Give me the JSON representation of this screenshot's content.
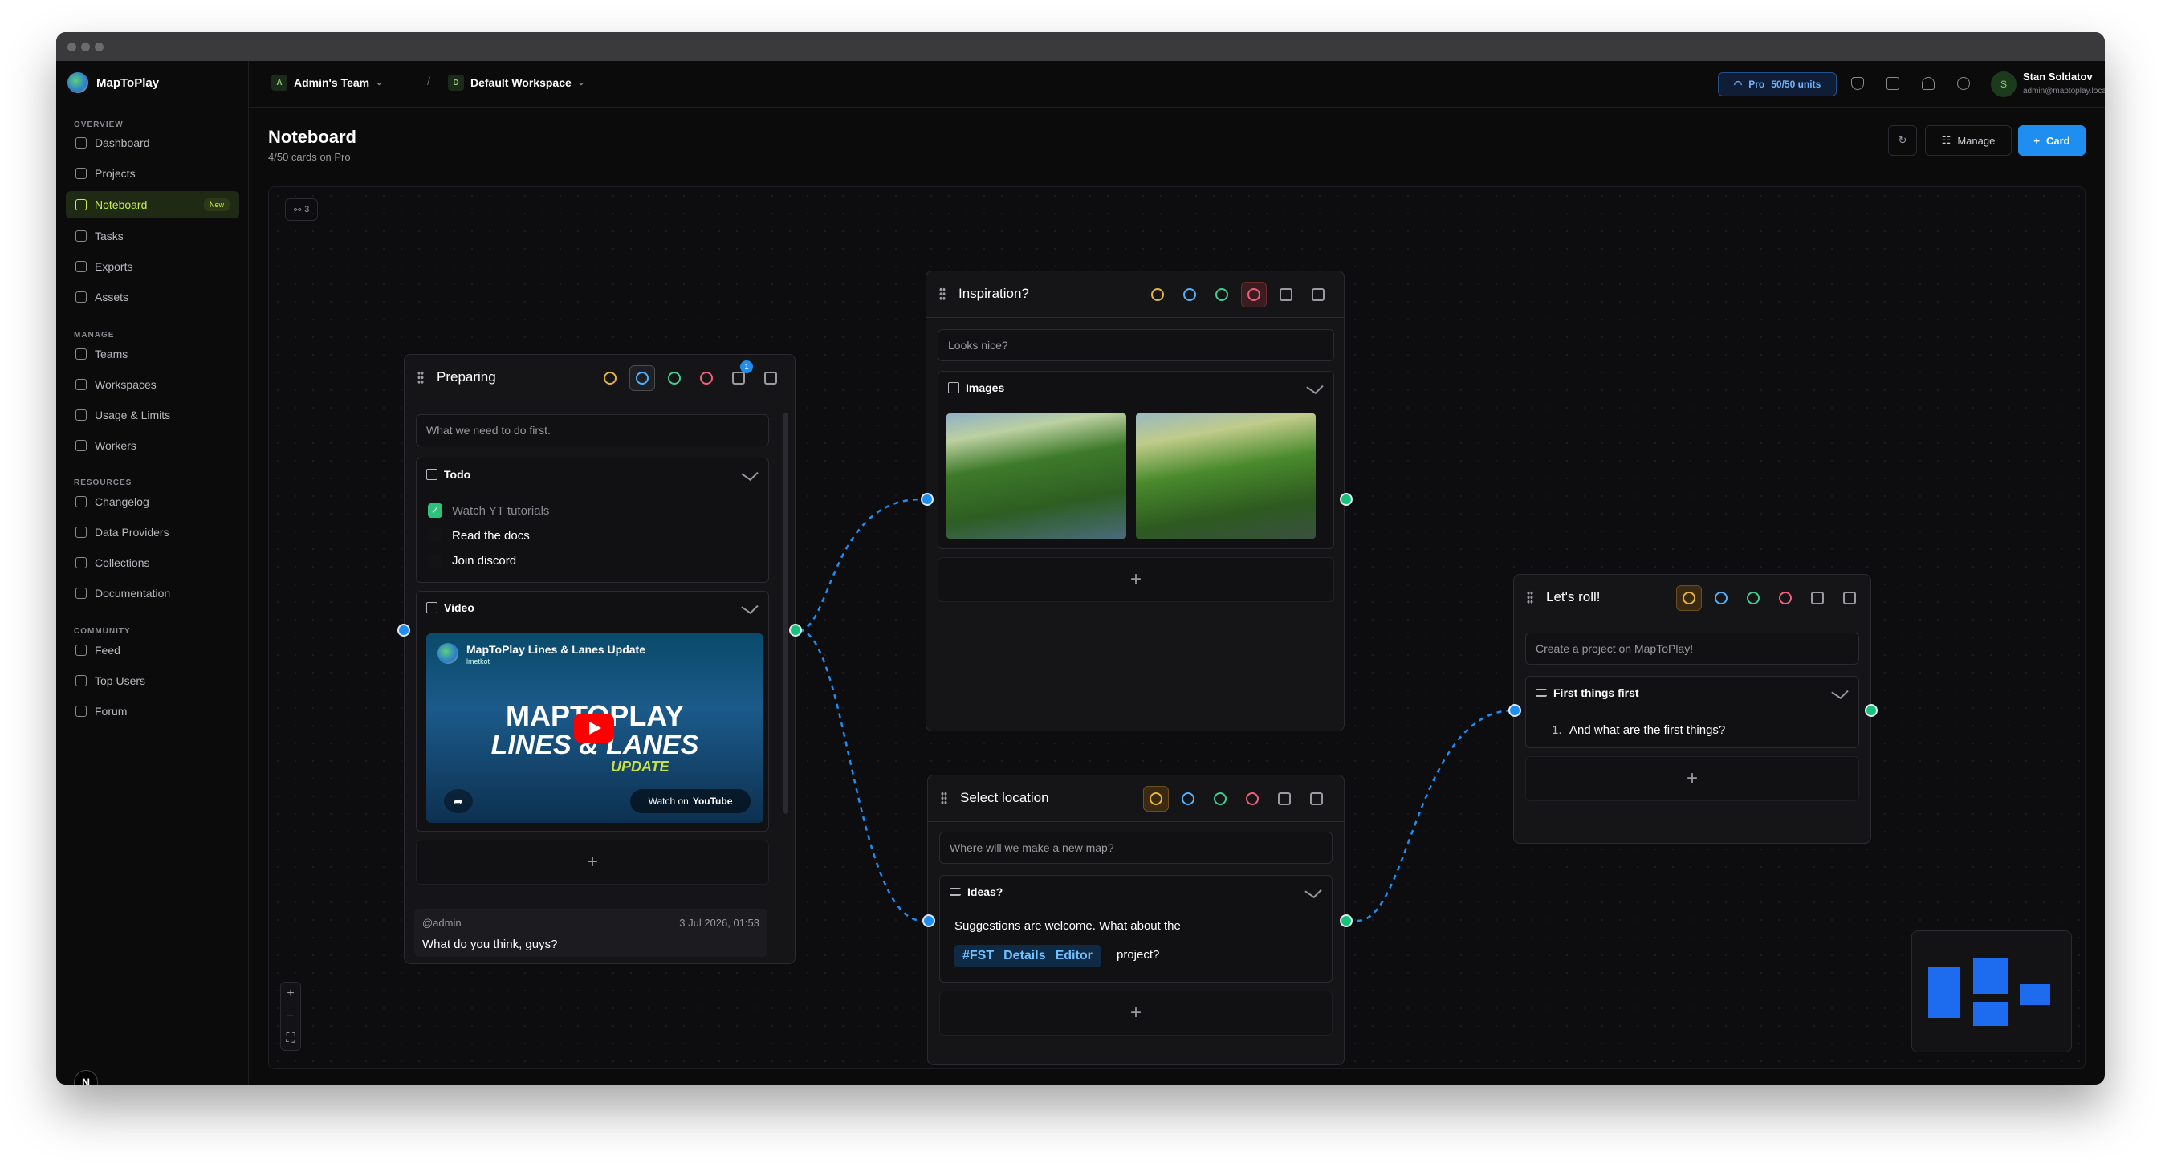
{
  "app": {
    "name": "MapToPlay"
  },
  "sidebar": {
    "sections": [
      {
        "title": "OVERVIEW",
        "items": [
          "Dashboard",
          "Projects",
          "Noteboard",
          "Tasks",
          "Exports",
          "Assets"
        ]
      },
      {
        "title": "MANAGE",
        "items": [
          "Teams",
          "Workspaces",
          "Usage & Limits",
          "Workers"
        ]
      },
      {
        "title": "RESOURCES",
        "items": [
          "Changelog",
          "Data Providers",
          "Collections",
          "Documentation"
        ]
      },
      {
        "title": "COMMUNITY",
        "items": [
          "Feed",
          "Top Users",
          "Forum"
        ]
      }
    ],
    "new_badge": "New",
    "bottom_logo": "N"
  },
  "topbar": {
    "team_initial": "A",
    "team": "Admin's Team",
    "sep": "/",
    "workspace_initial": "D",
    "workspace": "Default Workspace",
    "plan": "Pro",
    "units": "50/50 units",
    "user_initial": "S",
    "user_name": "Stan Soldatov",
    "user_email": "admin@maptoplay.local"
  },
  "page": {
    "title": "Noteboard",
    "subtitle": "4/50 cards on Pro",
    "manage_label": "Manage",
    "card_label": "Card"
  },
  "canvas": {
    "links_count": "3"
  },
  "cards": {
    "preparing": {
      "title": "Preparing",
      "description": "What we need to do first.",
      "comment_badge": "1",
      "todo_title": "Todo",
      "todos": [
        "Watch YT tutorials",
        "Read the docs",
        "Join discord"
      ],
      "video_title": "Video",
      "video_name": "MapToPlay Lines & Lanes Update",
      "video_channel": "lmetkot",
      "video_line1": "MAPTOPLAY",
      "video_line2": "LINES & LANES",
      "video_line3": "UPDATE",
      "video_watch": "Watch on",
      "video_yt": "YouTube",
      "comment_author": "@admin",
      "comment_date": "3 Jul 2026, 01:53",
      "comment_text": "What do you think, guys?"
    },
    "inspiration": {
      "title": "Inspiration?",
      "description": "Looks nice?",
      "images_title": "Images"
    },
    "select_location": {
      "title": "Select location",
      "description": "Where will we make a new map?",
      "ideas_title": "Ideas?",
      "ideas_text": "Suggestions are welcome. What about the",
      "tag_parts": [
        "#FST",
        "Details",
        "Editor"
      ],
      "ideas_tail": "project?"
    },
    "lets_roll": {
      "title": "Let's roll!",
      "description": "Create a project on MapToPlay!",
      "list_title": "First things first",
      "list_num": "1.",
      "list_item": "And what are the first things?"
    }
  },
  "colors": {
    "accent": "#1e8ef0",
    "active_nav": "#c8f04a",
    "handle_green": "#19c27a",
    "link": "#1e8ef0"
  }
}
